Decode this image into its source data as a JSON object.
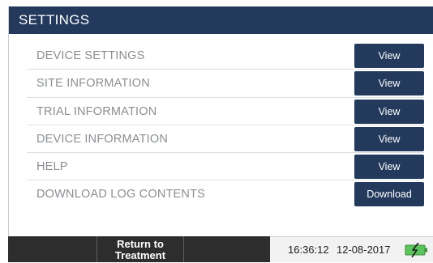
{
  "header": {
    "title": "SETTINGS"
  },
  "settings": {
    "items": [
      {
        "label": "DEVICE SETTINGS",
        "button": "View"
      },
      {
        "label": "SITE INFORMATION",
        "button": "View"
      },
      {
        "label": "TRIAL INFORMATION",
        "button": "View"
      },
      {
        "label": "DEVICE INFORMATION",
        "button": "View"
      },
      {
        "label": "HELP",
        "button": "View"
      },
      {
        "label": "DOWNLOAD LOG CONTENTS",
        "button": "Download"
      }
    ]
  },
  "footer": {
    "return_line1": "Return to",
    "return_line2": "Treatment",
    "time": "16:36:12",
    "date": "12-08-2017",
    "battery_icon": "battery-charging-icon"
  },
  "colors": {
    "header_bg": "#233a5c",
    "button_bg": "#233a5c",
    "label_text": "#8b8e93",
    "footer_bg": "#2d2d2d",
    "battery_fill": "#5cc45c"
  }
}
